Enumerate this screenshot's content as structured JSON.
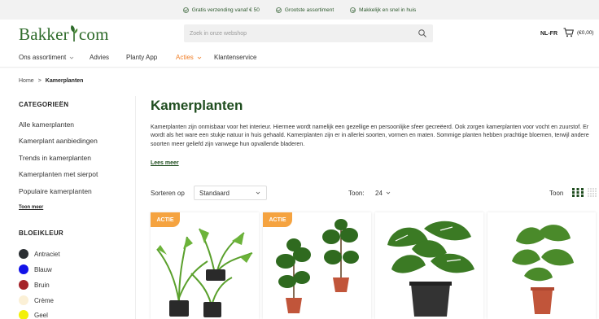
{
  "topbar": {
    "usps": [
      "Gratis verzending vanaf € 50",
      "Grootste assortiment",
      "Makkelijk en snel in huis"
    ]
  },
  "header": {
    "logo_left": "Bakker",
    "logo_right": "com",
    "search_placeholder": "Zoek in onze webshop",
    "language": "NL-FR",
    "cart_total": "(€0,00)"
  },
  "nav": {
    "items": [
      {
        "label": "Ons assortiment",
        "dropdown": true
      },
      {
        "label": "Advies",
        "dropdown": false
      },
      {
        "label": "Planty App",
        "dropdown": false
      },
      {
        "label": "Acties",
        "dropdown": true,
        "color": "#f07e26"
      },
      {
        "label": "Klantenservice",
        "dropdown": false
      }
    ]
  },
  "breadcrumb": {
    "home": "Home",
    "separator": ">",
    "current": "Kamerplanten"
  },
  "sidebar": {
    "categories_heading": "CATEGORIEËN",
    "categories": [
      "Alle kamerplanten",
      "Kamerplant aanbiedingen",
      "Trends in kamerplanten",
      "Kamerplanten met sierpot",
      "Populaire kamerplanten"
    ],
    "show_more": "Toon meer",
    "color_heading": "BLOEIKLEUR",
    "colors": [
      {
        "label": "Antraciet",
        "hex": "#2b2f33"
      },
      {
        "label": "Blauw",
        "hex": "#1212e8"
      },
      {
        "label": "Bruin",
        "hex": "#a5242a"
      },
      {
        "label": "Crème",
        "hex": "#fbf0d6"
      },
      {
        "label": "Geel",
        "hex": "#f3f00a"
      }
    ]
  },
  "main": {
    "title": "Kamerplanten",
    "description": "Kamerplanten zijn onmisbaar voor het interieur. Hiermee wordt namelijk een gezellige en persoonlijke sfeer gecreëerd. Ook zorgen kamerplanten voor vocht en zuurstof. Er wordt als het ware een stukje natuur in huis gehaald. Kamerplanten zijn er in allerlei soorten, vormen en maten. Sommige planten hebben prachtige bloemen, terwijl andere soorten meer geliefd zijn vanwege hun opvallende bladeren.",
    "read_more": "Lees meer",
    "sort_label": "Sorteren op",
    "sort_value": "Standaard",
    "show_label": "Toon:",
    "show_value": "24",
    "view_label": "Toon"
  },
  "products": [
    {
      "badge": "ACTIE",
      "plant": "areca-trio"
    },
    {
      "badge": "ACTIE",
      "plant": "ficus-lyrata-duo"
    },
    {
      "badge": "",
      "plant": "monstera"
    },
    {
      "badge": "",
      "plant": "monstera-small"
    }
  ],
  "colors": {
    "brand_green": "#2e6b2a",
    "accent_orange": "#f07e26",
    "badge_orange": "#f5a340"
  }
}
